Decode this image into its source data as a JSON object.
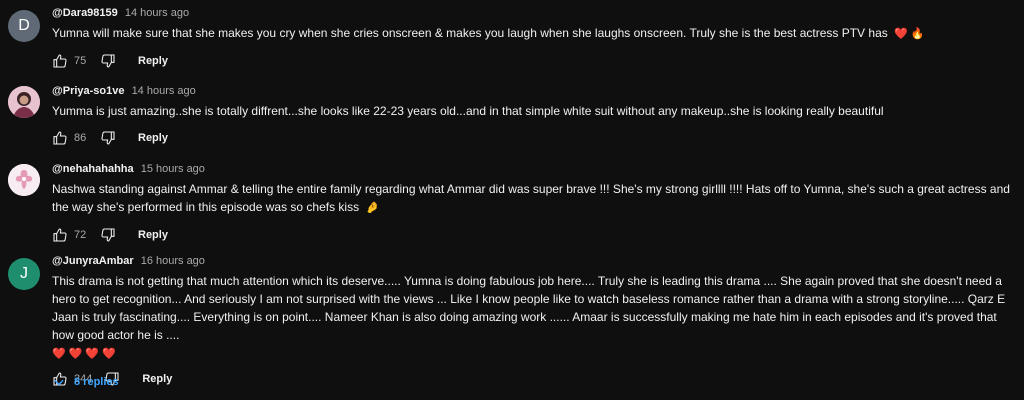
{
  "comments": [
    {
      "avatar_letter": "D",
      "avatar_color": "#5f6a76",
      "author": "@Dara98159",
      "time": "14 hours ago",
      "text": "Yumna will make sure that she makes you cry when she cries onscreen & makes you laugh when she laughs onscreen. Truly she is the best actress PTV has",
      "emoji": [
        "❤️",
        "🔥"
      ],
      "likes": "75",
      "reply_label": "Reply"
    },
    {
      "avatar_letter": "",
      "avatar_color": "#d9a7b8",
      "author": "@Priya-so1ve",
      "time": "14 hours ago",
      "text": "Yumma is just amazing..she is totally diffrent...she looks like 22-23 years old...and in that simple white suit without any makeup..she is looking really beautiful",
      "likes": "86",
      "reply_label": "Reply"
    },
    {
      "avatar_letter": "",
      "avatar_color": "#f3e8ee",
      "author": "@nehahahahha",
      "time": "15 hours ago",
      "text": "Nashwa standing against Ammar & telling the entire family regarding what Ammar did was super brave !!! She's my strong girllll !!!! Hats off to Yumna, she's such a great actress and the way she's performed in this episode was so chefs kiss",
      "emoji": [
        "🤌"
      ],
      "likes": "72",
      "reply_label": "Reply"
    },
    {
      "avatar_letter": "J",
      "avatar_color": "#1e8e6e",
      "author": "@JunyraAmbar",
      "time": "16 hours ago",
      "text": "This drama is not getting that much attention which its deserve..... Yumna is doing fabulous job here.... Truly she is leading this drama .... She again proved that she doesn't need a hero to get recognition... And  seriously I am not surprised with the views ... Like I know people like to watch baseless romance rather than a drama with a strong storyline..... Qarz E Jaan is truly fascinating.... Everything is on point.... Nameer Khan is also doing amazing work ...... Amaar is successfully making me hate him in each episodes and it's proved that how good actor he is ....",
      "emoji_line": "❤️❤️❤️❤️",
      "likes": "244",
      "reply_label": "Reply",
      "replies_label": "8 replies"
    }
  ],
  "colors": {
    "background": "#0f0f0f",
    "text": "#f1f1f1",
    "meta": "#aaaaaa",
    "link": "#3ea6ff"
  },
  "icons": {
    "like": "thumbs-up-icon",
    "dislike": "thumbs-down-icon",
    "expand": "chevron-down-icon"
  }
}
